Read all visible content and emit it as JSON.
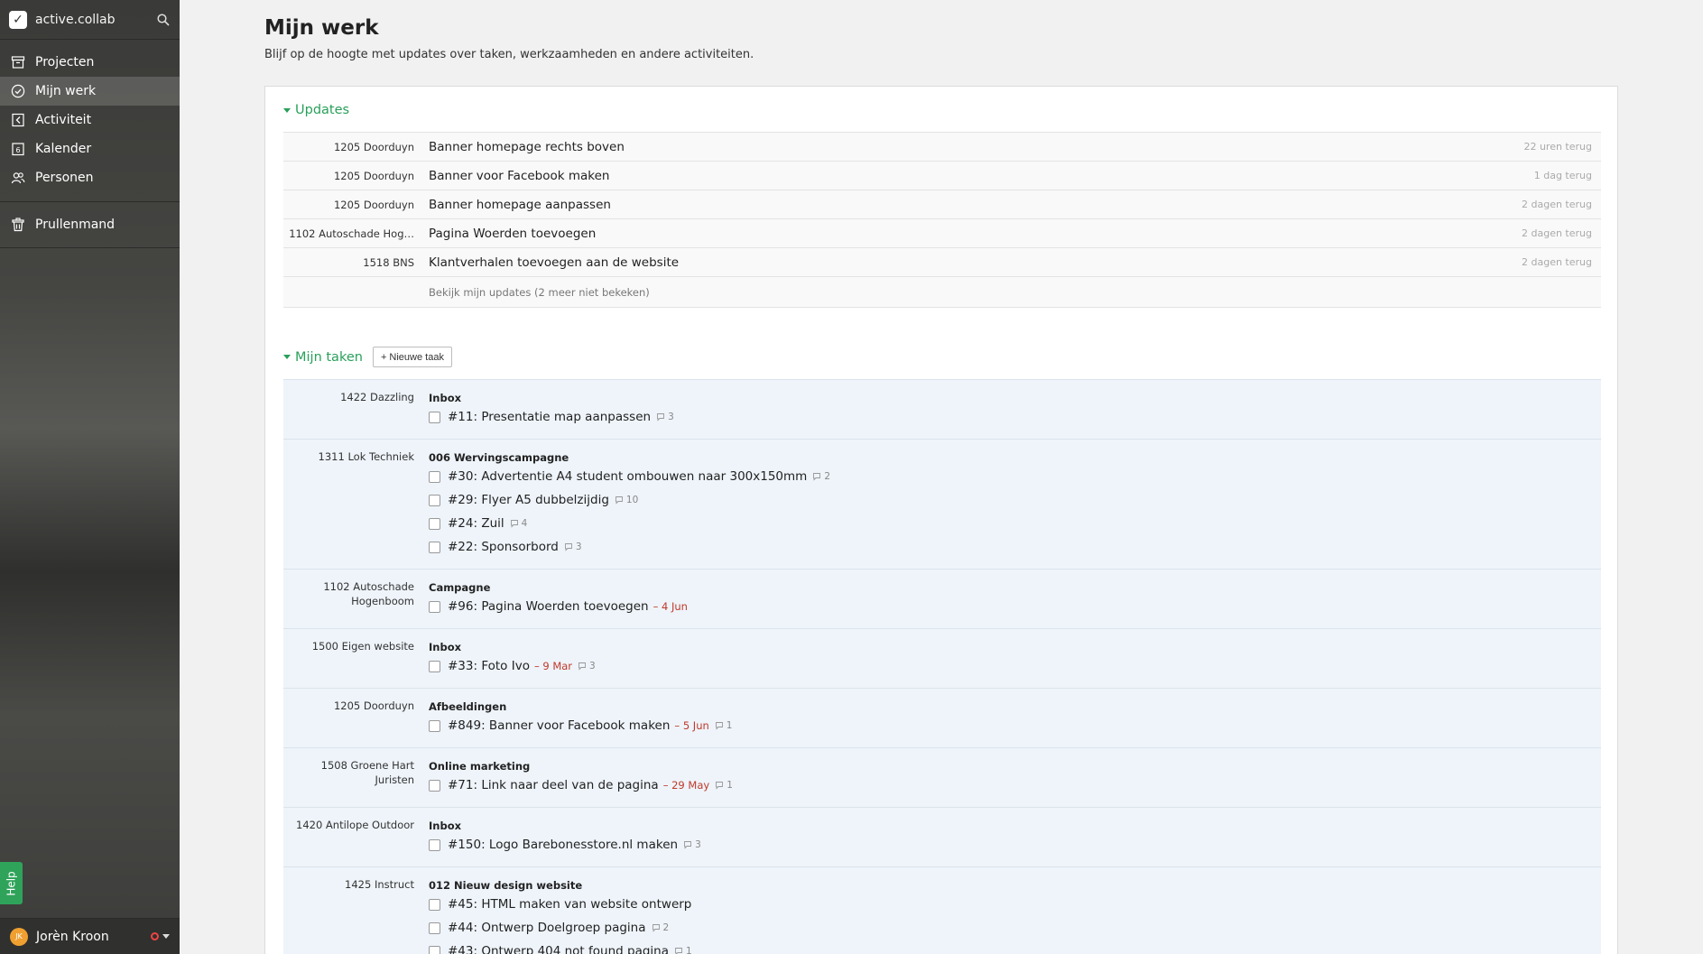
{
  "app": {
    "brand": "active.collab"
  },
  "sidebar": {
    "items": [
      {
        "label": "Projecten",
        "icon": "archive-icon"
      },
      {
        "label": "Mijn werk",
        "icon": "check-circle-icon",
        "active": true
      },
      {
        "label": "Activiteit",
        "icon": "activity-icon"
      },
      {
        "label": "Kalender",
        "icon": "calendar-icon",
        "calendar_day": "6"
      },
      {
        "label": "Personen",
        "icon": "people-icon"
      }
    ],
    "trash": {
      "label": "Prullenmand",
      "icon": "trash-icon"
    },
    "help": "Help",
    "user": {
      "name": "Jorèn Kroon",
      "initials": "JK"
    }
  },
  "page": {
    "title": "Mijn werk",
    "subtitle": "Blijf op de hoogte met updates over taken, werkzaamheden en andere activiteiten."
  },
  "updates": {
    "heading": "Updates",
    "rows": [
      {
        "project": "1205 Doorduyn",
        "title": "Banner homepage rechts boven",
        "time": "22 uren terug"
      },
      {
        "project": "1205 Doorduyn",
        "title": "Banner voor Facebook maken",
        "time": "1 dag terug"
      },
      {
        "project": "1205 Doorduyn",
        "title": "Banner homepage aanpassen",
        "time": "2 dagen terug"
      },
      {
        "project": "1102 Autoschade Hog…",
        "title": "Pagina Woerden toevoegen",
        "time": "2 dagen terug"
      },
      {
        "project": "1518 BNS",
        "title": "Klantverhalen toevoegen aan de website",
        "time": "2 dagen terug"
      }
    ],
    "more_link": "Bekijk mijn updates (2 meer niet bekeken)"
  },
  "tasks": {
    "heading": "Mijn taken",
    "new_task_label": "+ Nieuwe taak",
    "groups": [
      {
        "project": "1422 Dazzling",
        "list": "Inbox",
        "tasks": [
          {
            "title": "#11: Presentatie map aanpassen",
            "comments": "3"
          }
        ]
      },
      {
        "project": "1311 Lok Techniek",
        "list": "006 Wervingscampagne",
        "tasks": [
          {
            "title": "#30: Advertentie A4 student ombouwen naar 300x150mm",
            "comments": "2"
          },
          {
            "title": "#29: Flyer A5 dubbelzijdig",
            "comments": "10"
          },
          {
            "title": "#24: Zuil",
            "comments": "4"
          },
          {
            "title": "#22: Sponsorbord",
            "comments": "3"
          }
        ]
      },
      {
        "project": "1102 Autoschade Hogenboom",
        "list": "Campagne",
        "tasks": [
          {
            "title": "#96: Pagina Woerden toevoegen",
            "due": "– 4 Jun"
          }
        ]
      },
      {
        "project": "1500 Eigen website",
        "list": "Inbox",
        "tasks": [
          {
            "title": "#33: Foto Ivo",
            "due": "– 9 Mar",
            "comments": "3"
          }
        ]
      },
      {
        "project": "1205 Doorduyn",
        "list": "Afbeeldingen",
        "tasks": [
          {
            "title": "#849: Banner voor Facebook maken",
            "due": "– 5 Jun",
            "comments": "1"
          }
        ]
      },
      {
        "project": "1508 Groene Hart Juristen",
        "list": "Online marketing",
        "tasks": [
          {
            "title": "#71: Link naar deel van de pagina",
            "due": "– 29 May",
            "comments": "1"
          }
        ]
      },
      {
        "project": "1420 Antilope Outdoor",
        "list": "Inbox",
        "tasks": [
          {
            "title": "#150: Logo Barebonesstore.nl maken",
            "comments": "3"
          }
        ]
      },
      {
        "project": "1425 Instruct",
        "list": "012 Nieuw design website",
        "tasks": [
          {
            "title": "#45: HTML maken van website ontwerp"
          },
          {
            "title": "#44: Ontwerp Doelgroep pagina",
            "comments": "2"
          },
          {
            "title": "#43: Ontwerp 404 not found pagina",
            "comments": "1"
          }
        ]
      }
    ]
  }
}
